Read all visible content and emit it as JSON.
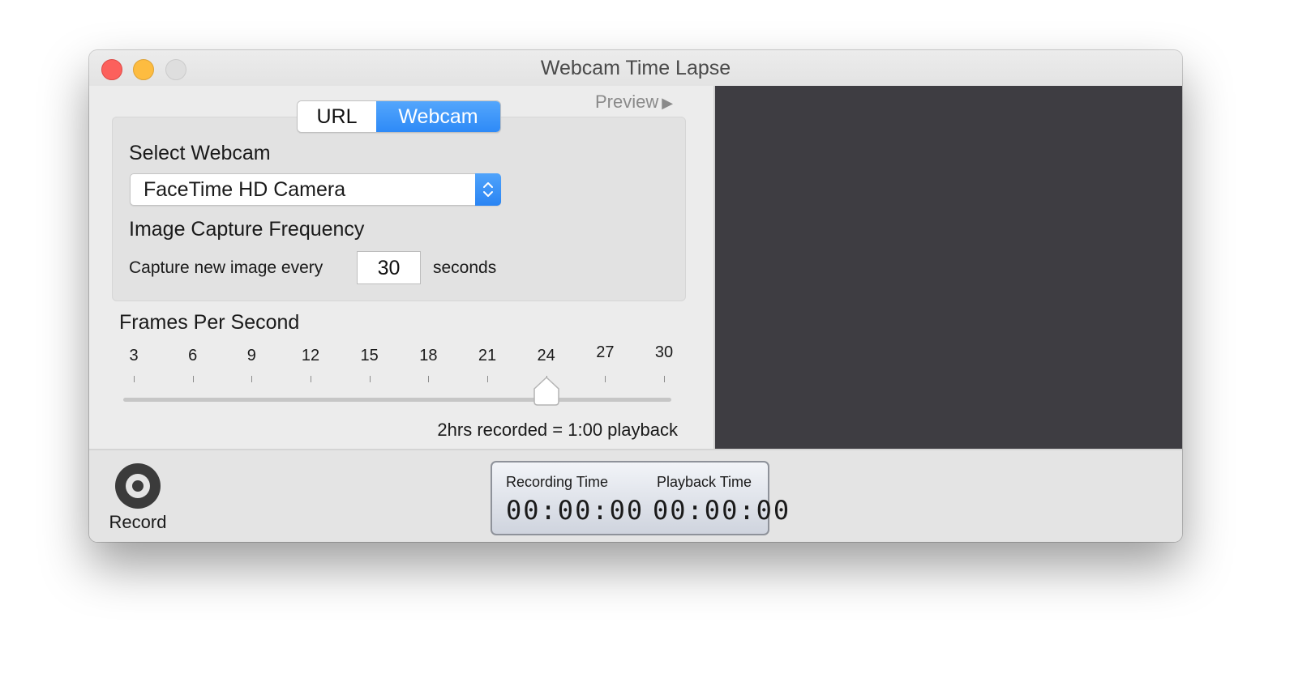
{
  "window": {
    "title": "Webcam Time Lapse"
  },
  "preview_toggle": {
    "label": "Preview",
    "icon": "play-triangle"
  },
  "source_tabs": [
    {
      "label": "URL",
      "selected": false
    },
    {
      "label": "Webcam",
      "selected": true
    }
  ],
  "webcam": {
    "section_title": "Select Webcam",
    "selected_camera": "FaceTime HD Camera",
    "frequency_title": "Image Capture Frequency",
    "capture_prefix": "Capture new image every",
    "capture_value": "30",
    "capture_suffix": "seconds"
  },
  "fps": {
    "title": "Frames Per Second",
    "ticks": [
      "3",
      "6",
      "9",
      "12",
      "15",
      "18",
      "21",
      "24",
      "27",
      "30"
    ],
    "value": 24,
    "min": 3,
    "max": 30
  },
  "summary": "2hrs recorded = 1:00 playback",
  "record": {
    "label": "Record",
    "icon": "record-icon"
  },
  "timers": {
    "recording_label": "Recording Time",
    "recording_value": "00:00:00",
    "playback_label": "Playback Time",
    "playback_value": "00:00:00"
  },
  "colors": {
    "accent_blue": "#2e8af7",
    "preview_bg": "#3e3d42",
    "close": "#fc605c",
    "minimize": "#fdbc40"
  }
}
